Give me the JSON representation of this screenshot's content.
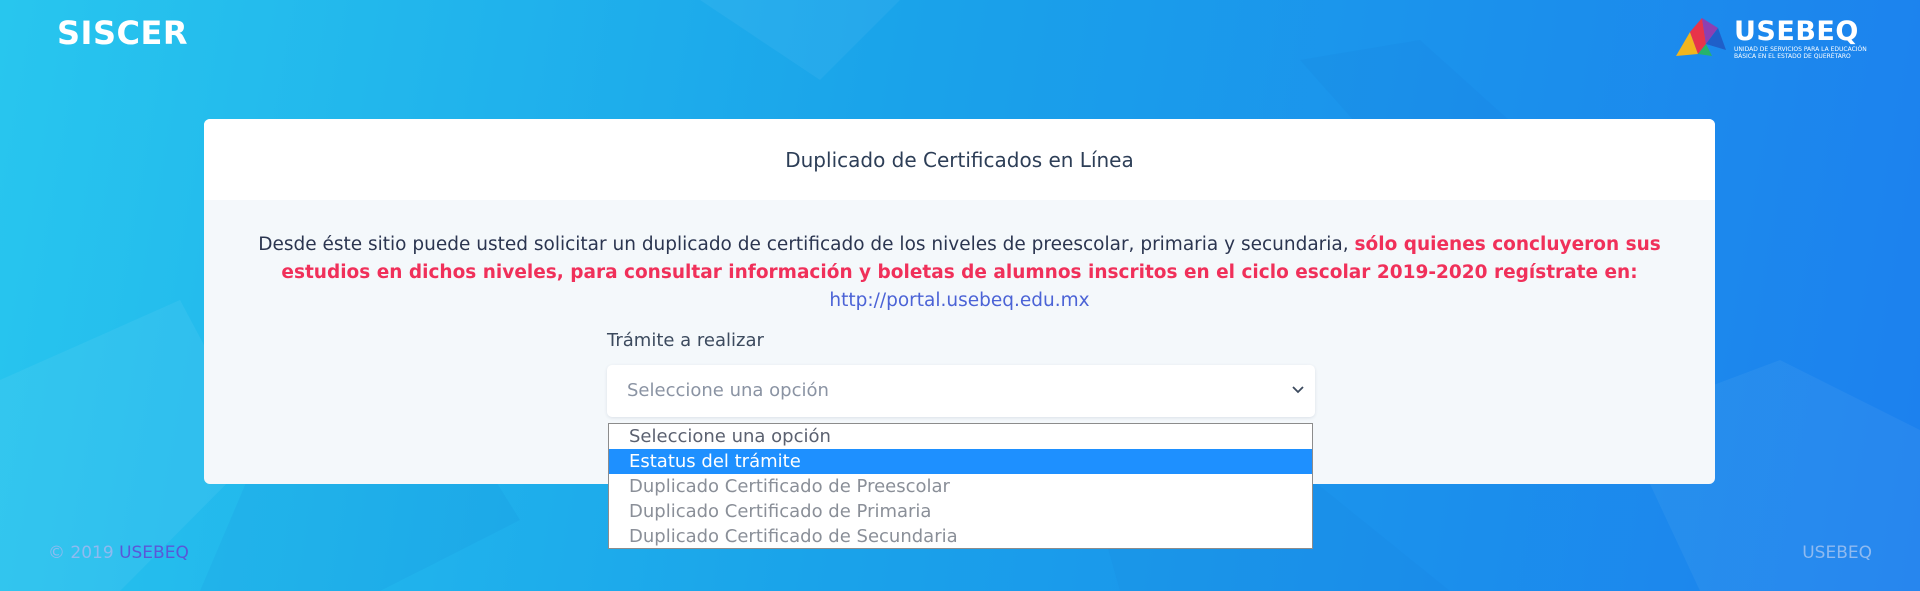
{
  "header": {
    "app_name": "SISCER",
    "logo": {
      "name": "USEBEQ",
      "tagline": "UNIDAD DE SERVICIOS PARA LA EDUCACIÓN BÁSICA EN EL ESTADO DE QUERÉTARO"
    }
  },
  "card": {
    "title": "Duplicado de Certificados en Línea",
    "intro": {
      "normal": "Desde éste sitio puede usted solicitar un duplicado de certificado de los niveles de preescolar, primaria y secundaria, ",
      "highlight": "sólo quienes concluyeron sus estudios en dichos niveles, para consultar información y boletas de alumnos inscritos en el ciclo escolar 2019-2020 regístrate en: ",
      "link": "http://portal.usebeq.edu.mx"
    },
    "field_label": "Trámite a realizar",
    "select": {
      "value": "Seleccione una opción",
      "icon": "chevron-down-icon",
      "options": [
        "Seleccione una opción",
        "Estatus del trámite",
        "Duplicado Certificado de Preescolar",
        "Duplicado Certificado de Primaria",
        "Duplicado Certificado de Secundaria"
      ],
      "highlighted_option": "Estatus del trámite"
    }
  },
  "footer": {
    "copyright": "© 2019",
    "copyright_link": "USEBEQ",
    "right": "USEBEQ"
  },
  "colors": {
    "accent": "#1e90ff",
    "warning_text": "#f0305a",
    "link": "#4b63d6"
  }
}
